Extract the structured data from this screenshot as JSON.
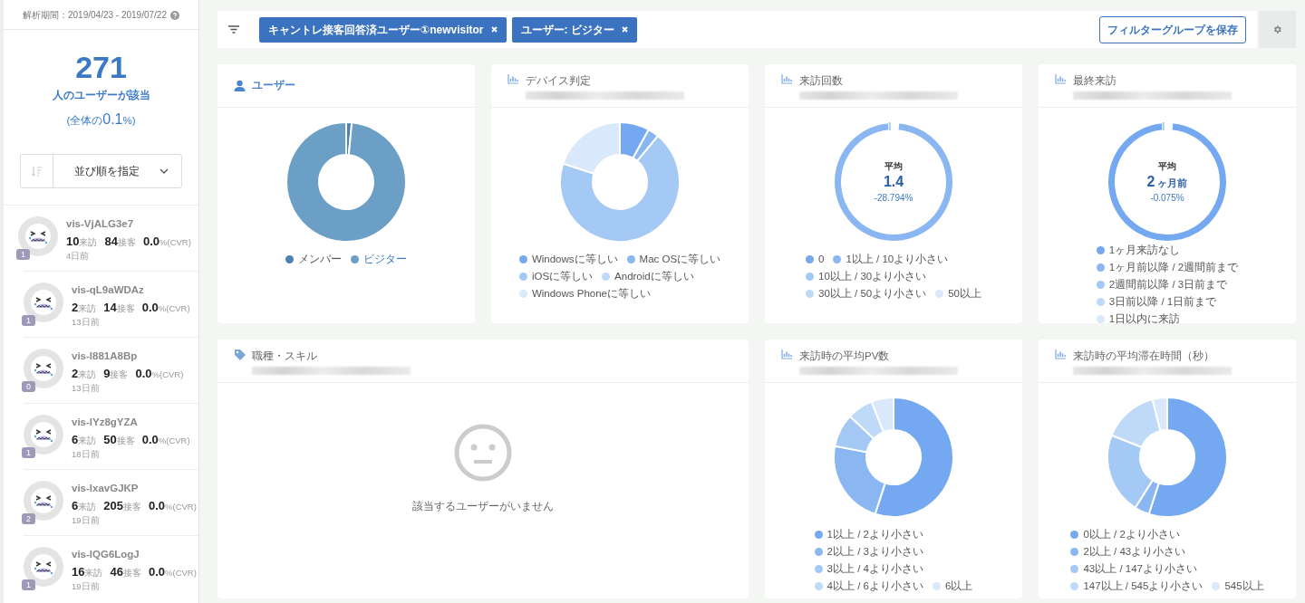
{
  "sidebar": {
    "period": "解析期間：2019/04/23 - 2019/07/22",
    "summary": {
      "count": "271",
      "label": "人のユーザーが該当",
      "share_open": "(全体の",
      "share_value": "0.1",
      "share_close": "%)"
    },
    "sort": {
      "label": "並び順を指定"
    },
    "visitors": [
      {
        "name": "vis-VjALG3e7",
        "badge": "1",
        "visits": "10",
        "visits_unit": "来訪",
        "contacts": "84",
        "contacts_unit": "接客",
        "cvr": "0.0",
        "cvr_unit": "%(CVR)",
        "ago": "4日前"
      },
      {
        "name": "vis-qL9aWDAz",
        "badge": "1",
        "visits": "2",
        "visits_unit": "来訪",
        "contacts": "14",
        "contacts_unit": "接客",
        "cvr": "0.0",
        "cvr_unit": "%(CVR)",
        "ago": "13日前"
      },
      {
        "name": "vis-l881A8Bp",
        "badge": "0",
        "visits": "2",
        "visits_unit": "来訪",
        "contacts": "9",
        "contacts_unit": "接客",
        "cvr": "0.0",
        "cvr_unit": "%(CVR)",
        "ago": "13日前"
      },
      {
        "name": "vis-lYz8gYZA",
        "badge": "1",
        "visits": "6",
        "visits_unit": "来訪",
        "contacts": "50",
        "contacts_unit": "接客",
        "cvr": "0.0",
        "cvr_unit": "%(CVR)",
        "ago": "18日前"
      },
      {
        "name": "vis-lxavGJKP",
        "badge": "2",
        "visits": "6",
        "visits_unit": "来訪",
        "contacts": "205",
        "contacts_unit": "接客",
        "cvr": "0.0",
        "cvr_unit": "%(CVR)",
        "ago": "19日前"
      },
      {
        "name": "vis-lQG6LogJ",
        "badge": "1",
        "visits": "16",
        "visits_unit": "来訪",
        "contacts": "46",
        "contacts_unit": "接客",
        "cvr": "0.0",
        "cvr_unit": "%(CVR)",
        "ago": "19日前"
      }
    ]
  },
  "filters": [
    {
      "label": "キャントレ接客回答済ユーザー①newvisitor"
    },
    {
      "label": "ユーザー: ビジター"
    }
  ],
  "save_button": "フィルターグループを保存",
  "cards": [
    {
      "kind": "donut",
      "title": "ユーザー",
      "legend_rows": [
        [
          {
            "label": "メンバー",
            "color": "#4f80b4",
            "selected": false
          },
          {
            "label": "ビジター",
            "color": "#6c9fc6",
            "selected": true
          }
        ]
      ]
    },
    {
      "kind": "donut",
      "title": "デバイス判定",
      "legend_rows": [
        [
          {
            "label": "Windowsに等しい",
            "color": "#74a8f0"
          },
          {
            "label": "Mac OSに等しい",
            "color": "#8ab7f2"
          }
        ],
        [
          {
            "label": "iOSに等しい",
            "color": "#a5c9f5"
          },
          {
            "label": "Androidに等しい",
            "color": "#bfd9f8"
          }
        ],
        [
          {
            "label": "Windows Phoneに等しい",
            "color": "#d9e8fb"
          }
        ]
      ]
    },
    {
      "kind": "ring",
      "title": "来訪回数",
      "center": {
        "label": "平均",
        "value": "1.4",
        "change": "-28.794%"
      },
      "legend_rows": [
        [
          {
            "label": "0",
            "color": "#74a8f0"
          },
          {
            "label": "1以上 / 10より小さい",
            "color": "#8ab7f2"
          }
        ],
        [
          {
            "label": "10以上 / 30より小さい",
            "color": "#a5c9f5"
          }
        ],
        [
          {
            "label": "30以上 / 50より小さい",
            "color": "#bfd9f8"
          },
          {
            "label": "50以上",
            "color": "#d9e8fb"
          }
        ]
      ]
    },
    {
      "kind": "ring",
      "title": "最終来訪",
      "center": {
        "label": "平均",
        "value": "2",
        "unit": "ヶ月前",
        "change": "-0.075%"
      },
      "legend_rows": [
        [
          {
            "label": "1ヶ月来訪なし",
            "color": "#74a8f0"
          }
        ],
        [
          {
            "label": "1ヶ月前以降 / 2週間前まで",
            "color": "#8ab7f2"
          }
        ],
        [
          {
            "label": "2週間前以降 / 3日前まで",
            "color": "#a5c9f5"
          }
        ],
        [
          {
            "label": "3日前以降 / 1日前まで",
            "color": "#bfd9f8"
          }
        ],
        [
          {
            "label": "1日以内に来訪",
            "color": "#d9e8fb"
          }
        ]
      ]
    },
    {
      "kind": "empty",
      "title": "職種・スキル",
      "message": "該当するユーザーがいません"
    },
    {
      "kind": "donut",
      "title": "来訪時の平均PV数",
      "legend_rows": [
        [
          {
            "label": "1以上 / 2より小さい",
            "color": "#74a8f0"
          }
        ],
        [
          {
            "label": "2以上 / 3より小さい",
            "color": "#8ab7f2"
          }
        ],
        [
          {
            "label": "3以上 / 4より小さい",
            "color": "#a5c9f5"
          }
        ],
        [
          {
            "label": "4以上 / 6より小さい",
            "color": "#bfd9f8"
          },
          {
            "label": "6以上",
            "color": "#d9e8fb"
          }
        ]
      ]
    },
    {
      "kind": "donut",
      "title": "来訪時の平均滞在時間（秒）",
      "legend_rows": [
        [
          {
            "label": "0以上 / 2より小さい",
            "color": "#74a8f0"
          }
        ],
        [
          {
            "label": "2以上 / 43より小さい",
            "color": "#8ab7f2"
          }
        ],
        [
          {
            "label": "43以上 / 147より小さい",
            "color": "#a5c9f5"
          }
        ],
        [
          {
            "label": "147以上 / 545より小さい",
            "color": "#bfd9f8"
          },
          {
            "label": "545以上",
            "color": "#d9e8fb"
          }
        ]
      ]
    }
  ]
}
